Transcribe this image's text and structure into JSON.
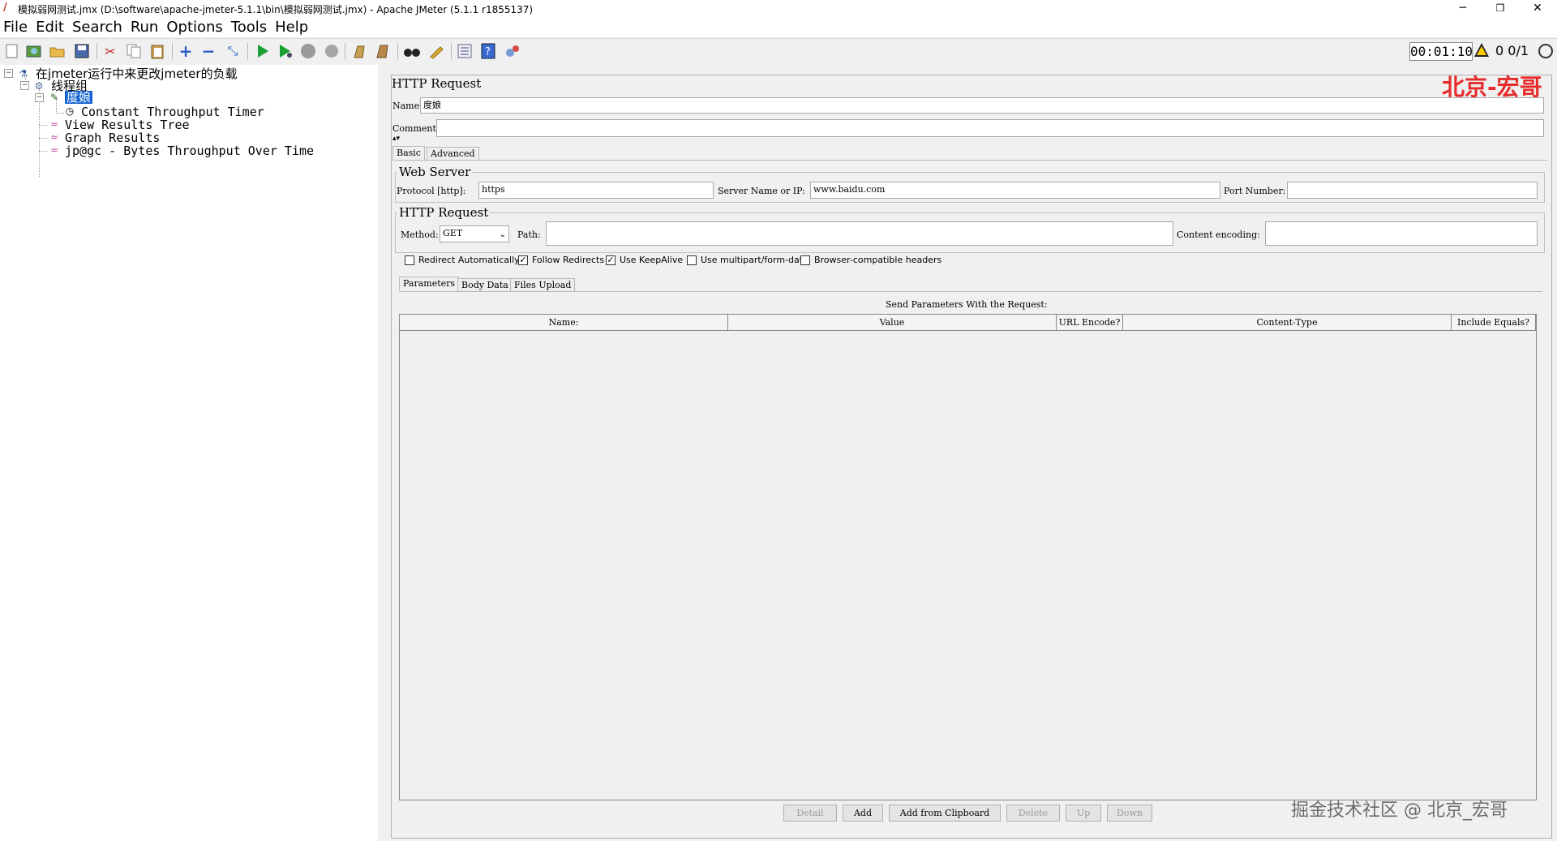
{
  "window": {
    "title": "模拟弱网测试.jmx (D:\\software\\apache-jmeter-5.1.1\\bin\\模拟弱网测试.jmx) - Apache JMeter (5.1.1 r1855137)",
    "minimize": "─",
    "restore": "❐",
    "close": "✕"
  },
  "menu": [
    "File",
    "Edit",
    "Search",
    "Run",
    "Options",
    "Tools",
    "Help"
  ],
  "toolbar": {
    "timer": "00:01:10",
    "counts": "0  0/1"
  },
  "tree": {
    "root": "在jmeter运行中来更改jmeter的负载",
    "thread_group": "线程组",
    "sampler": "度娘",
    "timer": "Constant Throughput Timer",
    "listener1": "View Results Tree",
    "listener2": "Graph Results",
    "listener3": "jp@gc - Bytes Throughput Over Time"
  },
  "panel": {
    "title": "HTTP Request",
    "watermark": "北京-宏哥",
    "name_label": "Name:",
    "name_value": "度娘",
    "comments_label": "Comments:",
    "tabs": [
      "Basic",
      "Advanced"
    ],
    "web_server": {
      "title": "Web Server",
      "protocol_label": "Protocol [http]:",
      "protocol_value": "https",
      "server_label": "Server Name or IP:",
      "server_value": "www.baidu.com",
      "port_label": "Port Number:",
      "port_value": ""
    },
    "http_request": {
      "title": "HTTP Request",
      "method_label": "Method:",
      "method_value": "GET",
      "path_label": "Path:",
      "path_value": "",
      "encoding_label": "Content encoding:",
      "encoding_value": ""
    },
    "checkboxes": [
      {
        "label": "Redirect Automatically",
        "checked": false
      },
      {
        "label": "Follow Redirects",
        "checked": true
      },
      {
        "label": "Use KeepAlive",
        "checked": true
      },
      {
        "label": "Use multipart/form-data",
        "checked": false
      },
      {
        "label": "Browser-compatible headers",
        "checked": false
      }
    ],
    "param_tabs": [
      "Parameters",
      "Body Data",
      "Files Upload"
    ],
    "params_title": "Send Parameters With the Request:",
    "columns": [
      "Name:",
      "Value",
      "URL Encode?",
      "Content-Type",
      "Include Equals?"
    ],
    "buttons": [
      {
        "label": "Detail",
        "enabled": false
      },
      {
        "label": "Add",
        "enabled": true
      },
      {
        "label": "Add from Clipboard",
        "enabled": true
      },
      {
        "label": "Delete",
        "enabled": false
      },
      {
        "label": "Up",
        "enabled": false
      },
      {
        "label": "Down",
        "enabled": false
      }
    ]
  },
  "bottom_watermark": "掘金技术社区 @ 北京_宏哥",
  "colors": {
    "selection": "#1464d2",
    "watermark_red": "#e82a2a"
  }
}
